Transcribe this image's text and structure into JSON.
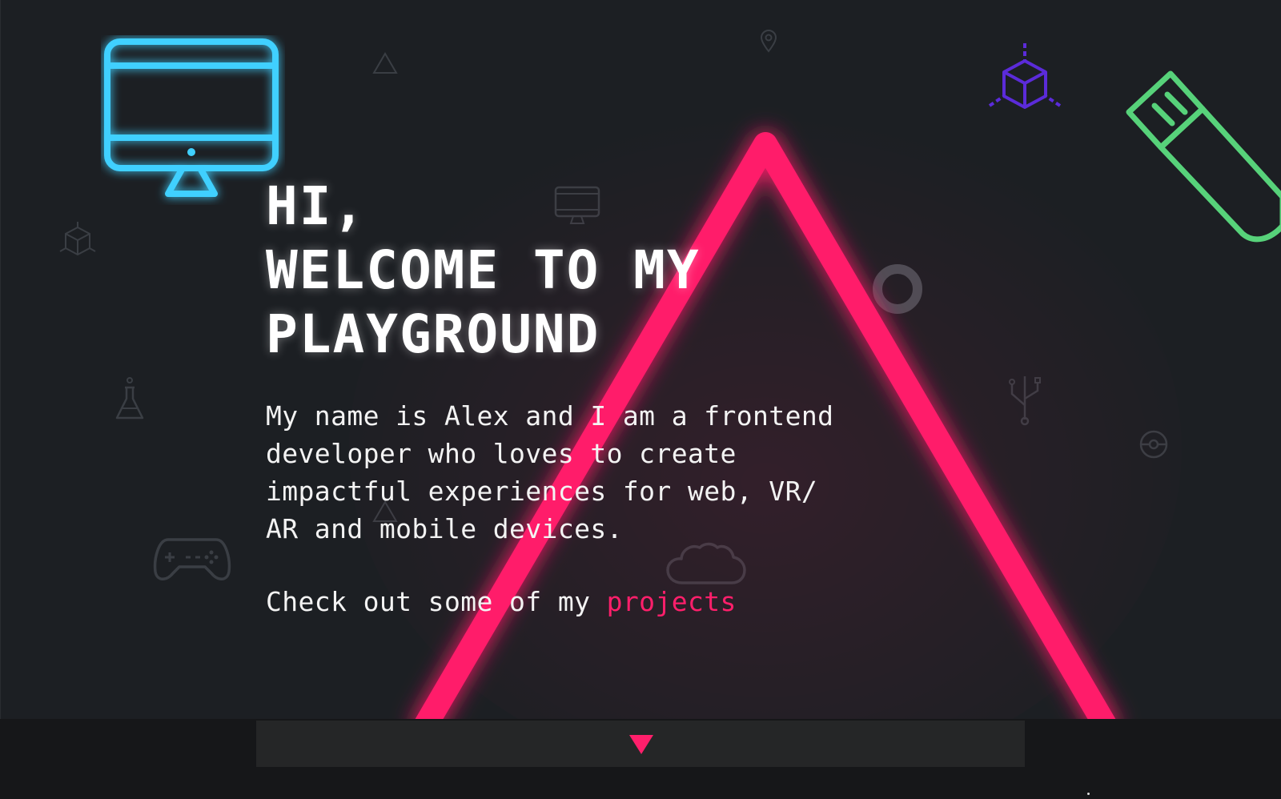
{
  "hero": {
    "title": "HI,\nWELCOME TO MY\nPLAYGROUND",
    "intro": "My name is Alex and I am a frontend developer who loves to create impactful experiences for web, VR/ AR and mobile devices.",
    "cta_prefix": "Check out some of my ",
    "cta_link": "projects"
  },
  "colors": {
    "background": "#1c1f23",
    "accent_pink": "#ff1f6b",
    "neon_blue": "#3fd0ff",
    "neon_green": "#57d27a",
    "neon_purple": "#5b2bd9"
  },
  "icons": [
    "monitor-icon",
    "cube-icon",
    "usb-drive-icon",
    "gamepad-icon",
    "flask-icon",
    "cloud-icon",
    "usb-symbol-icon",
    "pokeball-icon",
    "map-pin-icon",
    "small-triangle-icon",
    "ring-icon"
  ],
  "scroll_indicator": {
    "icon": "triangle-down-icon"
  }
}
